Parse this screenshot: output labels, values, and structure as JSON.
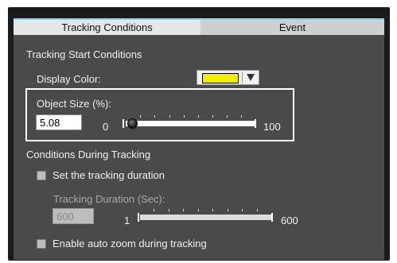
{
  "tabs": [
    {
      "label": "Tracking Conditions",
      "active": true
    },
    {
      "label": "Event",
      "active": false
    }
  ],
  "tracking_start": {
    "heading": "Tracking Start Conditions",
    "display_color_label": "Display Color:",
    "display_color_value": "#f5f000",
    "object_size_label": "Object Size (%):",
    "object_size_value": "5.08",
    "object_size_slider": {
      "min_label": "0",
      "max_label": "100",
      "value": 5.08
    }
  },
  "during_tracking": {
    "heading": "Conditions During Tracking",
    "set_duration_label": "Set the tracking duration",
    "set_duration_checked": false,
    "duration_label": "Tracking Duration (Sec):",
    "duration_value": "600",
    "duration_slider": {
      "min_label": "1",
      "max_label": "600",
      "value": 600
    },
    "auto_zoom_label": "Enable auto zoom during tracking",
    "auto_zoom_checked": false
  }
}
